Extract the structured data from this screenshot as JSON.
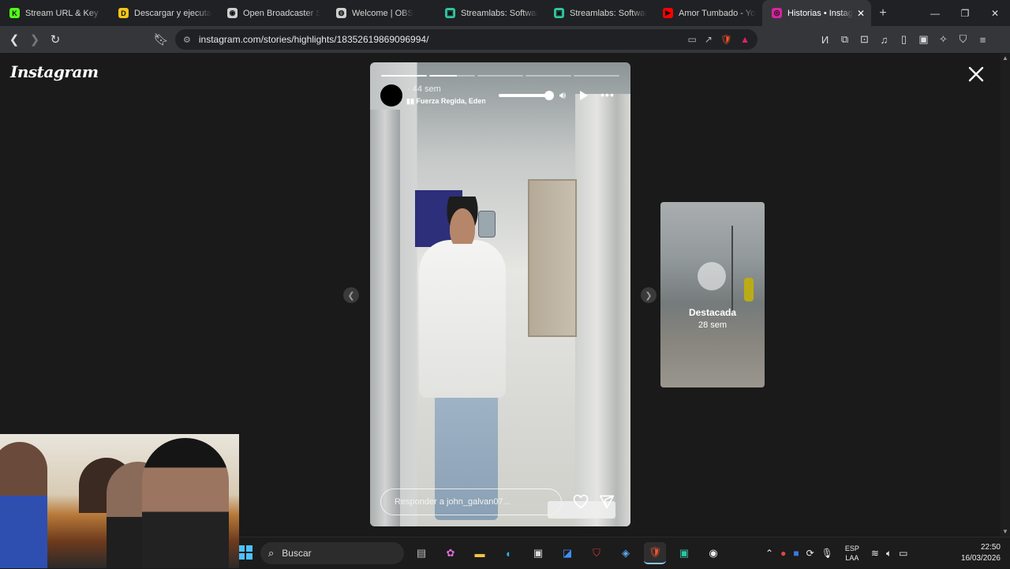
{
  "browser": {
    "tabs": [
      {
        "title": "Stream URL & Key - K",
        "favicon_color": "#53fc18",
        "favicon_glyph": "K"
      },
      {
        "title": "Descargar y ejecutar P",
        "favicon_color": "#f5c518",
        "favicon_glyph": "D"
      },
      {
        "title": "Open Broadcaster Sof",
        "favicon_color": "#cfcfcf",
        "favicon_glyph": "◉"
      },
      {
        "title": "Welcome | OBS",
        "favicon_color": "#cfcfcf",
        "favicon_glyph": "◍"
      },
      {
        "title": "Streamlabs: Software",
        "favicon_color": "#31c3a2",
        "favicon_glyph": "▣"
      },
      {
        "title": "Streamlabs: Software",
        "favicon_color": "#31c3a2",
        "favicon_glyph": "▣"
      },
      {
        "title": "Amor Tumbado - You",
        "favicon_color": "#ff0000",
        "favicon_glyph": "▶"
      },
      {
        "title": "Historias • Instag",
        "favicon_color": "#d6249f",
        "favicon_glyph": "◎",
        "active": true
      }
    ],
    "url": "instagram.com/stories/highlights/18352619869096994/"
  },
  "instagram": {
    "logo": "Instagram",
    "story": {
      "time": "44 sem",
      "song": "Fuerza Regida, Eden",
      "reply_placeholder": "Responder a john_galvan07...",
      "progress_segments": 5,
      "current_segment": 2,
      "current_progress": 0.6
    },
    "next_highlight": {
      "name": "Destacada",
      "age": "28 sem"
    }
  },
  "taskbar": {
    "search_label": "Buscar",
    "lang_line1": "ESP",
    "lang_line2": "LAA",
    "time": "22:50",
    "date": "16/03/2026"
  }
}
